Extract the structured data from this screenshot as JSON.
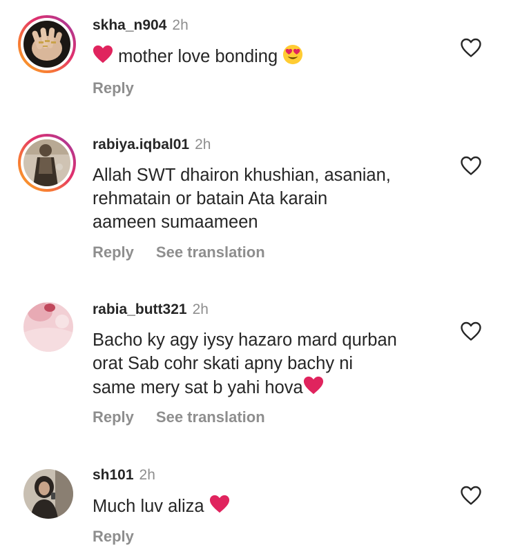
{
  "comments": [
    {
      "username": "skha_n904",
      "time": "2h",
      "text_parts": [
        "",
        "mother love bonding",
        ""
      ],
      "reply_label": "Reply",
      "avatar_icon": "avatar-hand-rings",
      "story_ring": true,
      "liked": false
    },
    {
      "username": "rabiya.iqbal01",
      "time": "2h",
      "lines": [
        "Allah SWT dhairon khushian, asanian,",
        "rehmatain or batain Ata karain",
        "aameen sumaameen"
      ],
      "reply_label": "Reply",
      "translation_label": "See translation",
      "avatar_icon": "avatar-person-dress",
      "story_ring": true,
      "liked": false
    },
    {
      "username": "rabia_butt321",
      "time": "2h",
      "lines": [
        "Bacho ky agy iysy hazaro mard qurban",
        "orat Sab cohr skati apny bachy ni",
        "same mery sat b yahi hova"
      ],
      "reply_label": "Reply",
      "translation_label": "See translation",
      "avatar_icon": "avatar-pink-photo",
      "story_ring": false,
      "liked": false
    },
    {
      "username": "sh101",
      "time": "2h",
      "text": "Much luv aliza",
      "reply_label": "Reply",
      "avatar_icon": "avatar-selfie",
      "story_ring": false,
      "liked": false
    }
  ],
  "icons": {
    "heart_outline": "heart-outline-icon",
    "red_heart_emoji": "red-heart-emoji",
    "heart_eyes_emoji": "heart-eyes-emoji"
  },
  "colors": {
    "text": "#262626",
    "secondary": "#8e8e8e",
    "red_heart": "#e0245e"
  }
}
